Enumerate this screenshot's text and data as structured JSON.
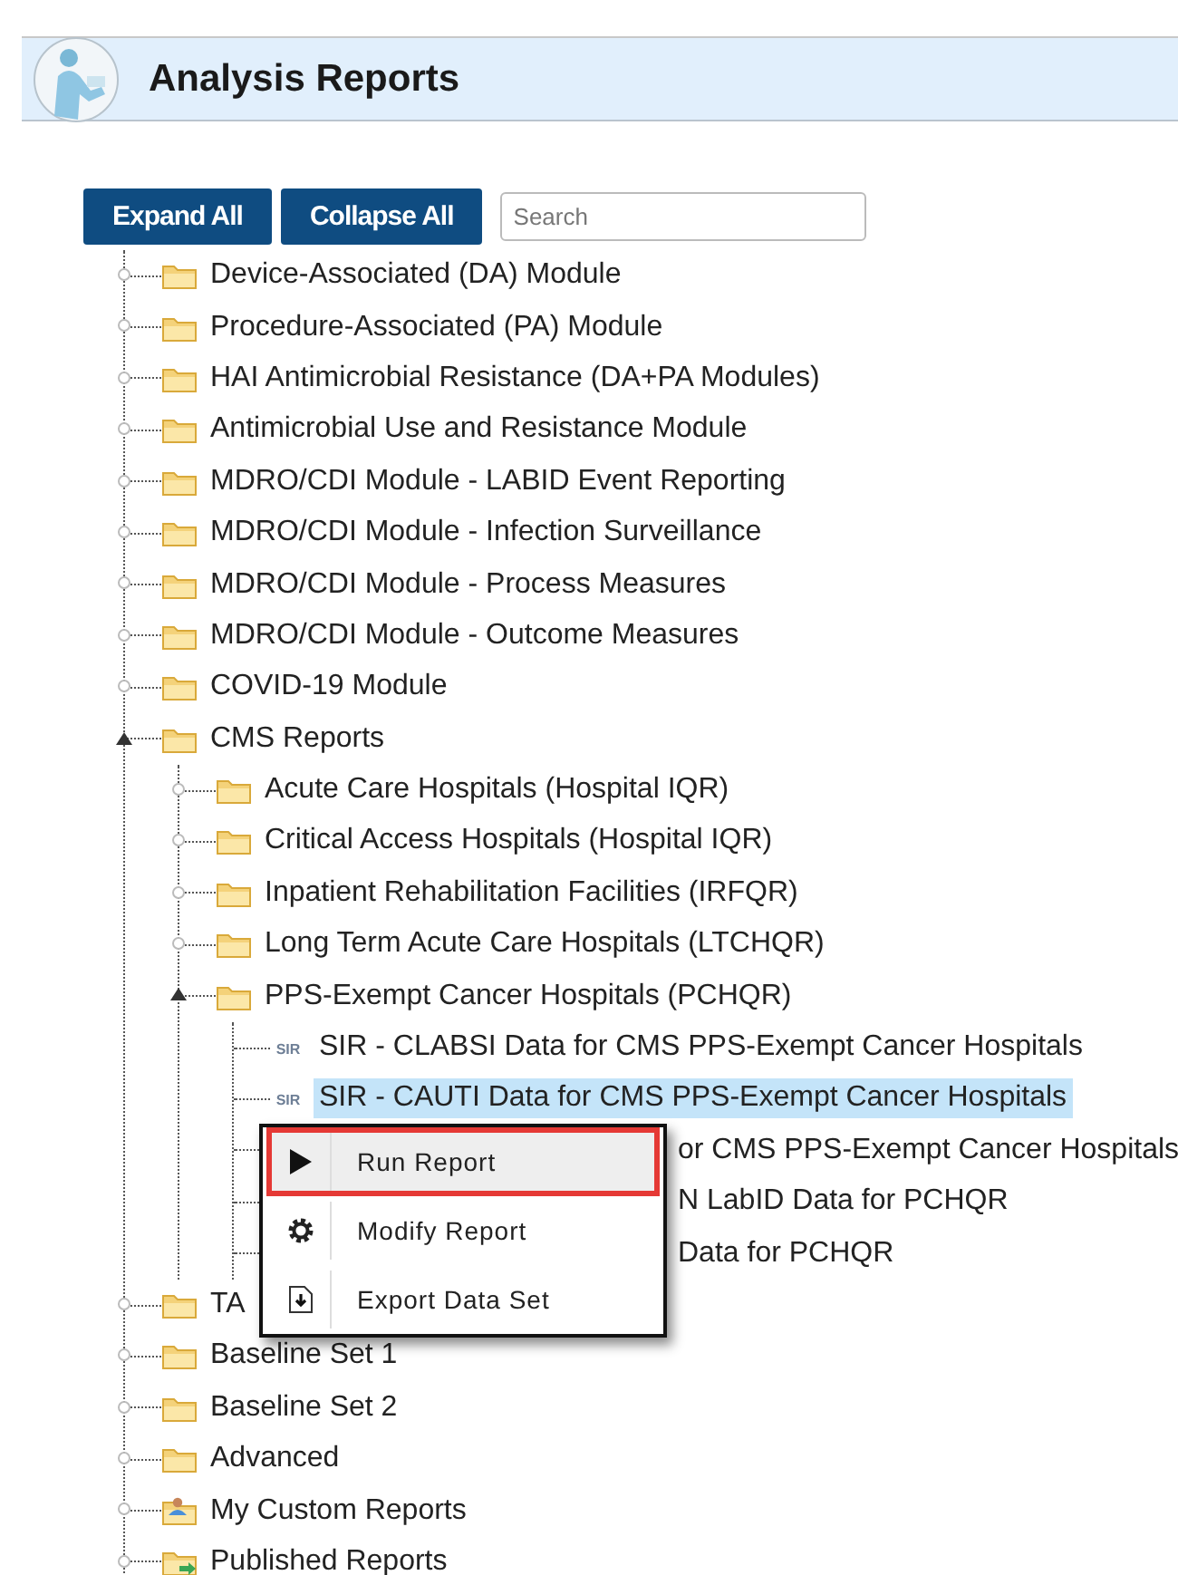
{
  "header": {
    "title": "Analysis Reports"
  },
  "toolbar": {
    "buttons": [
      "Expand All",
      "Collapse All"
    ],
    "search": {
      "placeholder": "Search"
    }
  },
  "tree": [
    {
      "label": "Device-Associated (DA) Module",
      "kind": "folder",
      "expanded": false
    },
    {
      "label": "Procedure-Associated (PA) Module",
      "kind": "folder",
      "expanded": false
    },
    {
      "label": "HAI Antimicrobial Resistance (DA+PA Modules)",
      "kind": "folder",
      "expanded": false
    },
    {
      "label": "Antimicrobial Use and Resistance Module",
      "kind": "folder",
      "expanded": false
    },
    {
      "label": "MDRO/CDI Module - LABID Event Reporting",
      "kind": "folder",
      "expanded": false
    },
    {
      "label": "MDRO/CDI Module - Infection Surveillance",
      "kind": "folder",
      "expanded": false
    },
    {
      "label": "MDRO/CDI Module - Process Measures",
      "kind": "folder",
      "expanded": false
    },
    {
      "label": "MDRO/CDI Module - Outcome Measures",
      "kind": "folder",
      "expanded": false
    },
    {
      "label": "COVID-19 Module",
      "kind": "folder",
      "expanded": false
    },
    {
      "label": "CMS Reports",
      "kind": "folder",
      "expanded": true,
      "children": [
        {
          "label": "Acute Care Hospitals (Hospital IQR)",
          "kind": "folder",
          "expanded": false
        },
        {
          "label": "Critical Access Hospitals (Hospital IQR)",
          "kind": "folder",
          "expanded": false
        },
        {
          "label": "Inpatient Rehabilitation Facilities (IRFQR)",
          "kind": "folder",
          "expanded": false
        },
        {
          "label": "Long Term Acute Care Hospitals (LTCHQR)",
          "kind": "folder",
          "expanded": false
        },
        {
          "label": "PPS-Exempt Cancer Hospitals (PCHQR)",
          "kind": "folder",
          "expanded": true,
          "children": [
            {
              "label": "SIR - CLABSI Data for CMS PPS-Exempt Cancer Hospitals",
              "kind": "report",
              "badge": "SIR",
              "selected": false
            },
            {
              "label": "SIR - CAUTI Data for CMS PPS-Exempt Cancer Hospitals",
              "kind": "report",
              "badge": "SIR",
              "selected": true
            },
            {
              "label": "or CMS PPS-Exempt Cancer Hospitals",
              "kind": "report",
              "selected": false,
              "partly_covered": true
            },
            {
              "label": "N LabID Data for PCHQR",
              "kind": "report",
              "selected": false,
              "partly_covered": true
            },
            {
              "label": "Data for PCHQR",
              "kind": "report",
              "selected": false,
              "partly_covered": true
            }
          ]
        }
      ]
    },
    {
      "label": "TA",
      "kind": "folder",
      "expanded": false
    },
    {
      "label": "Baseline Set 1",
      "kind": "folder",
      "expanded": false
    },
    {
      "label": "Baseline Set 2",
      "kind": "folder",
      "expanded": false
    },
    {
      "label": "Advanced",
      "kind": "folder",
      "expanded": false
    },
    {
      "label": "My Custom Reports",
      "kind": "custom",
      "expanded": false
    },
    {
      "label": "Published Reports",
      "kind": "published",
      "expanded": false
    }
  ],
  "context_menu": [
    {
      "label": "Run Report",
      "kind": "run",
      "selected": true
    },
    {
      "label": "Modify Report",
      "kind": "modify",
      "selected": false
    },
    {
      "label": "Export Data Set",
      "kind": "export",
      "selected": false
    }
  ]
}
